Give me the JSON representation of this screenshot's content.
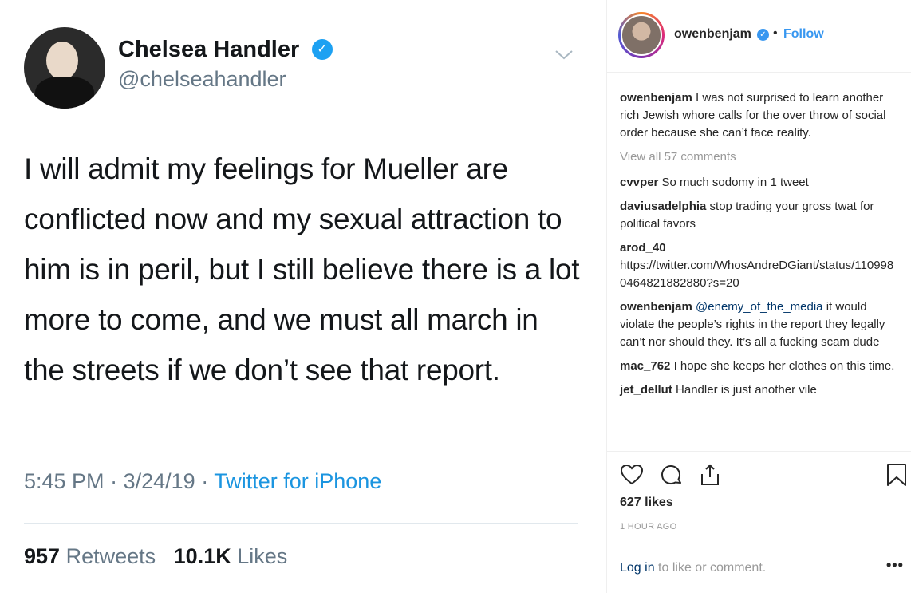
{
  "tweet": {
    "name": "Chelsea Handler",
    "handle": "@chelseahandler",
    "text": "I will admit my feelings for Mueller are conflicted now and my sexual attraction to him is in peril, but I still believe there is a lot more to come, and we must all march in the streets if we don’t see that report.",
    "time": "5:45 PM",
    "date": "3/24/19",
    "source": "Twitter for iPhone",
    "retweets_count": "957",
    "retweets_label": "Retweets",
    "likes_count": "10.1K",
    "likes_label": "Likes",
    "verified_glyph": "✓"
  },
  "instagram": {
    "username": "owenbenjam",
    "follow_label": "Follow",
    "separator": "•",
    "verified_glyph": "✓",
    "caption": {
      "user": "owenbenjam",
      "text": "I was not surprised to learn another rich Jewish whore calls for the over throw of social order because she can’t face reality."
    },
    "view_all": "View all 57 comments",
    "comments": [
      {
        "user": "cvvper",
        "text": "So much sodomy in 1 tweet"
      },
      {
        "user": "daviusadelphia",
        "text": "stop trading your gross twat for political favors"
      },
      {
        "user": "arod_40",
        "text": "https://twitter.com/WhosAndreDGiant/status/1109980464821882880?s=20"
      },
      {
        "user": "owenbenjam",
        "mention": "@enemy_of_the_media",
        "text": "it would violate the people’s rights in the report they legally can’t nor should they. It’s all a fucking scam dude"
      },
      {
        "user": "mac_762",
        "text": "I hope she keeps her clothes on this time."
      },
      {
        "user": "jet_dellut",
        "text": "Handler is just another vile"
      }
    ],
    "likes": "627 likes",
    "time_ago": "1 HOUR AGO",
    "login_link": "Log in",
    "login_rest": "to like or comment.",
    "more": "•••"
  }
}
